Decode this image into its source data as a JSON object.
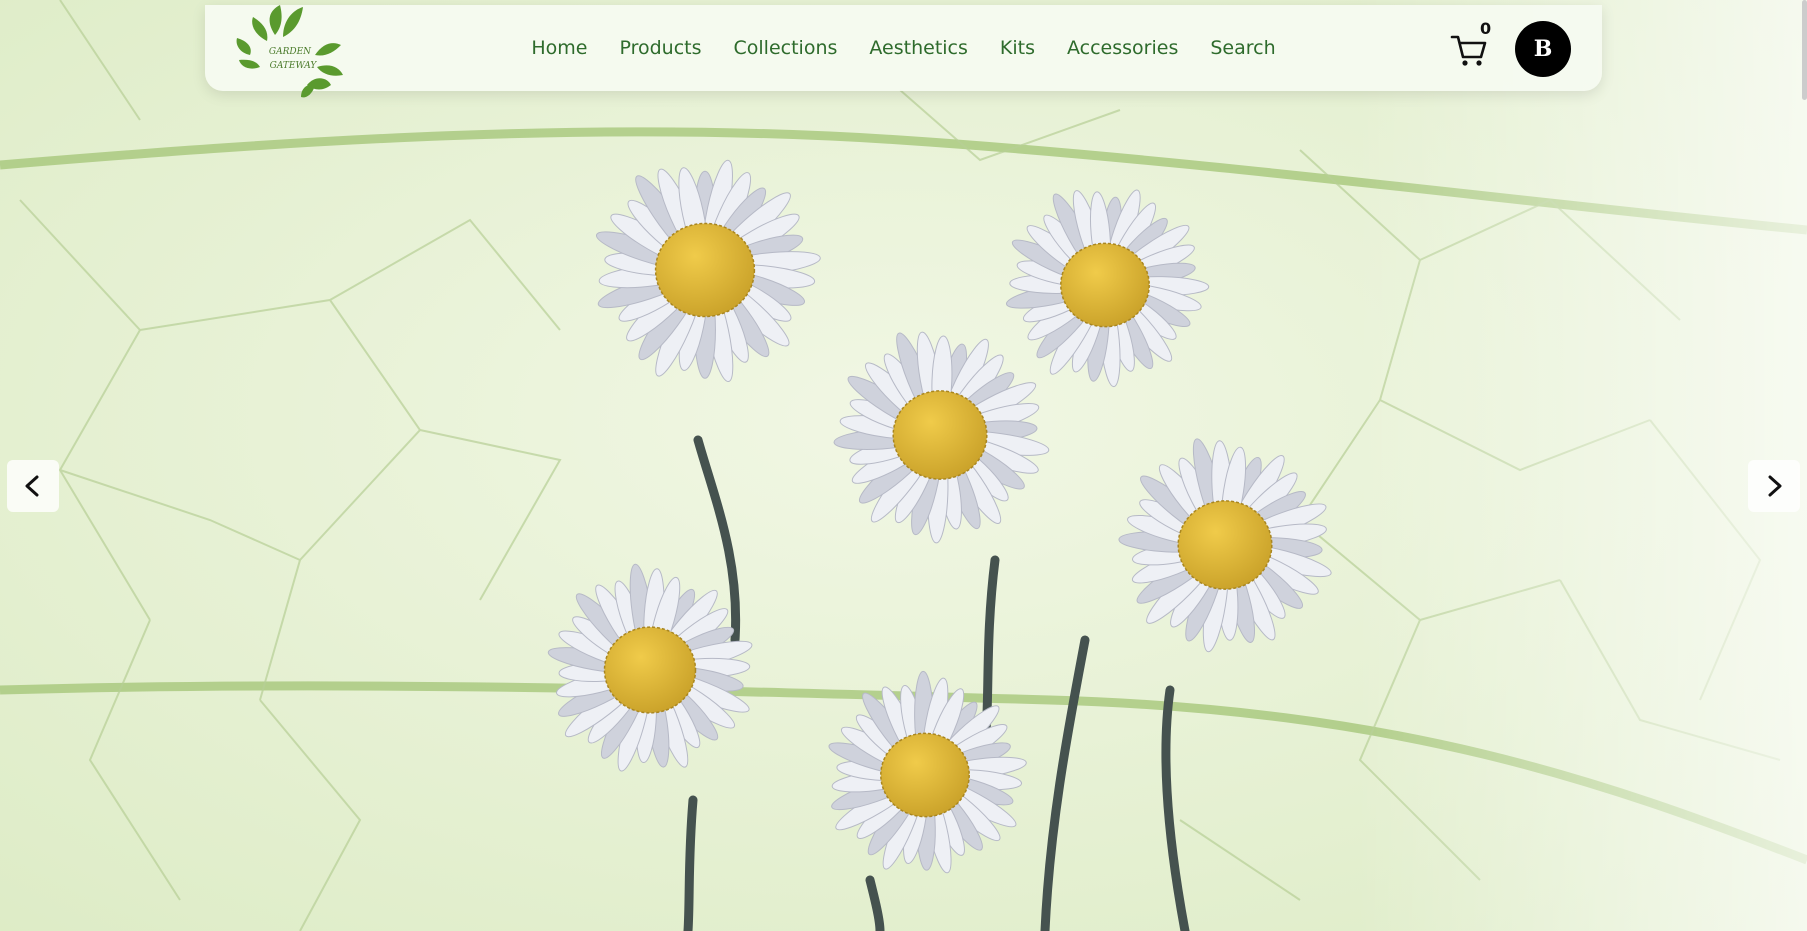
{
  "nav": {
    "logo_line1": "GARDEN",
    "logo_line2": "GATEWAY",
    "links": [
      "Home",
      "Products",
      "Collections",
      "Aesthetics",
      "Kits",
      "Accessories",
      "Search"
    ],
    "cart_count": "0",
    "avatar_initial": "B"
  },
  "hero": {
    "left_arrow_icon": "chevron-left-icon",
    "right_arrow_icon": "chevron-right-icon"
  },
  "colors": {
    "brand_green": "#2e6b2c",
    "background": "#e9f3d9",
    "daisy_center": "#e2b73a"
  }
}
